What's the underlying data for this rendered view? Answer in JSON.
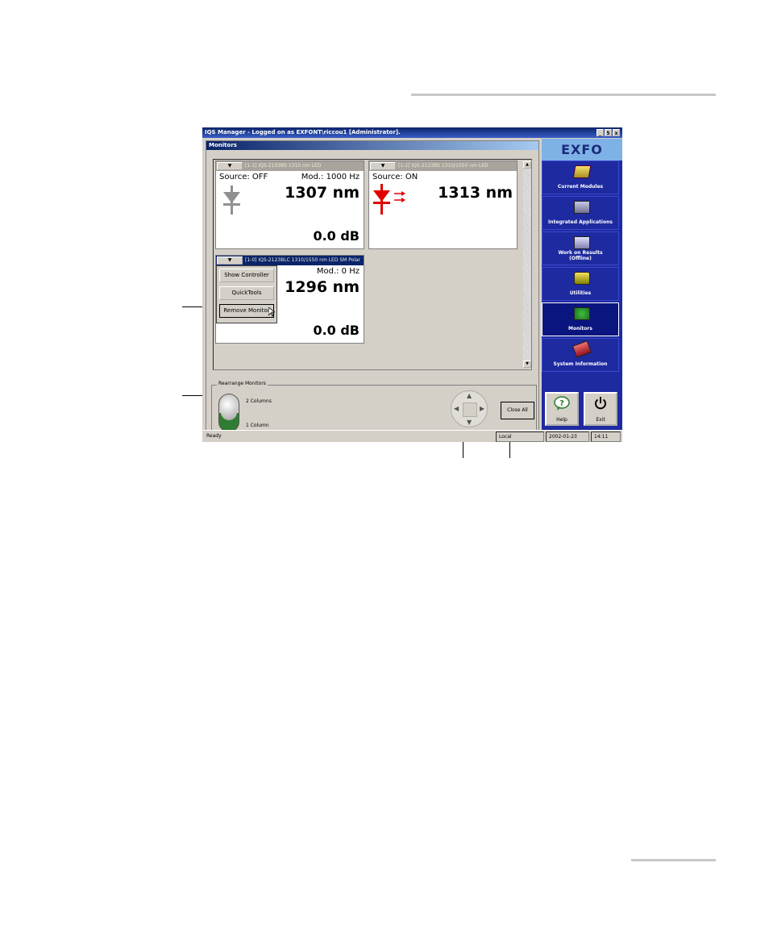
{
  "window": {
    "title": "IQS Manager - Logged on as EXFONT\\riccou1 [Administrator].",
    "minimize_glyph": "_",
    "maximize_glyph": "5",
    "close_glyph": "x"
  },
  "monitors_pane": {
    "header": "Monitors",
    "panels": [
      {
        "dropdown_glyph": "▼",
        "title": "[1-1] IQS-2103BS 1310 nm LED",
        "source": "Source: OFF",
        "mod": "Mod.: 1000 Hz",
        "wavelength": "1307 nm",
        "power": "0.0 dB",
        "source_on": false
      },
      {
        "dropdown_glyph": "▼",
        "title": "[1-2] IQS-2123BS 1310/1550 nm LED",
        "source": "Source: ON",
        "mod": "",
        "wavelength": "1313 nm",
        "power": "",
        "source_on": true
      },
      {
        "dropdown_glyph": "▼",
        "title": "[1-0] IQS-2123BLC 1310/1550 nm LED SM Polar",
        "source": "",
        "mod": "Mod.: 0 Hz",
        "wavelength": "1296 nm",
        "power": "0.0 dB",
        "source_on": false
      }
    ],
    "context_menu": {
      "items": [
        "Show Controller",
        "QuickTools",
        "Remove Monitor"
      ],
      "selected_index": 2
    },
    "rearrange": {
      "label": "Rearrange Monitors",
      "option_top": "2 Columns",
      "option_bottom": "1 Column"
    },
    "close_all_label": "Close All"
  },
  "sidebar": {
    "logo": "EXFO",
    "items": [
      {
        "label": "Current Modules",
        "icon": "modules-icon"
      },
      {
        "label": "Integrated Applications",
        "icon": "applications-icon"
      },
      {
        "label": "Work on Results (Offline)",
        "icon": "results-icon"
      },
      {
        "label": "Utilities",
        "icon": "utilities-icon"
      },
      {
        "label": "Monitors",
        "icon": "monitors-icon",
        "active": true
      },
      {
        "label": "System Information",
        "icon": "system-information-icon"
      }
    ],
    "help_label": "Help",
    "exit_label": "Exit"
  },
  "statusbar": {
    "status": "Ready",
    "mode": "Local",
    "date": "2002-01-23",
    "time": "14:11"
  },
  "colors": {
    "source_off": "#909090",
    "source_on": "#e00000",
    "sidebar_bg": "#1e2aa0",
    "active_titlebar": "#0a246a"
  }
}
